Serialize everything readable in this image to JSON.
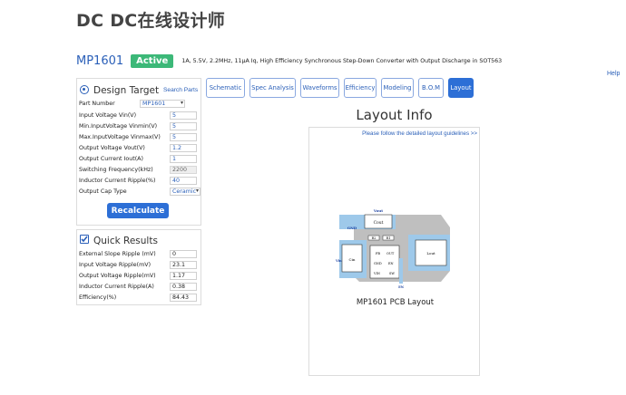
{
  "app": {
    "title": "DC DC在线设计师",
    "help": "Help"
  },
  "part": {
    "name": "MP1601",
    "status": "Active",
    "description": "1A, 5.5V, 2.2MHz, 11μA Iq, High Efficiency Synchronous Step-Down Converter with Output Discharge in SOT563"
  },
  "design_target": {
    "title": "Design Target",
    "search_link": "Search Parts",
    "part_number_label": "Part Number",
    "part_number_value": "MP1601",
    "fields": [
      {
        "label": "Input Voltage Vin(V)",
        "value": "5"
      },
      {
        "label": "Min.InputVoltage Vinmin(V)",
        "value": "5"
      },
      {
        "label": "Max.InputVoltage Vinmax(V)",
        "value": "5"
      },
      {
        "label": "Output Voltage Vout(V)",
        "value": "1.2"
      },
      {
        "label": "Output Current Iout(A)",
        "value": "1"
      },
      {
        "label": "Switching Frequency(kHz)",
        "value": "2200"
      },
      {
        "label": "Inductor Current Ripple(%)",
        "value": "40"
      },
      {
        "label": "Output Cap Type",
        "value": "Ceramic"
      }
    ],
    "recalc_label": "Recalculate"
  },
  "quick_results": {
    "title": "Quick Results",
    "rows": [
      {
        "label": "External Slope Ripple (mV)",
        "value": "0"
      },
      {
        "label": "Input Voltage Ripple(mV)",
        "value": "23.1"
      },
      {
        "label": "Output Voltage Ripple(mV)",
        "value": "1.17"
      },
      {
        "label": "Inductor Current Ripple(A)",
        "value": "0.38"
      },
      {
        "label": "Efficiency(%)",
        "value": "84.43"
      }
    ]
  },
  "tabs": [
    "Schematic",
    "Spec Analysis",
    "Waveforms",
    "Efficiency",
    "Modeling",
    "B.O.M",
    "Layout"
  ],
  "layout": {
    "title": "Layout Info",
    "guidelines_link": "Please follow the detailed layout guidelines >>",
    "caption": "MP1601 PCB Layout",
    "pcb_labels": {
      "vout": "Vout",
      "cout": "Cout",
      "gnd": "GND",
      "r2": "R2",
      "r1": "R1",
      "cin": "Cin",
      "vin": "Vin",
      "fb": "FB",
      "out": "OUT",
      "pin_gnd": "GND",
      "en": "EN",
      "vin_pin": "VIN",
      "sw": "SW",
      "lout": "Lout",
      "en_bottom": "EN"
    }
  }
}
